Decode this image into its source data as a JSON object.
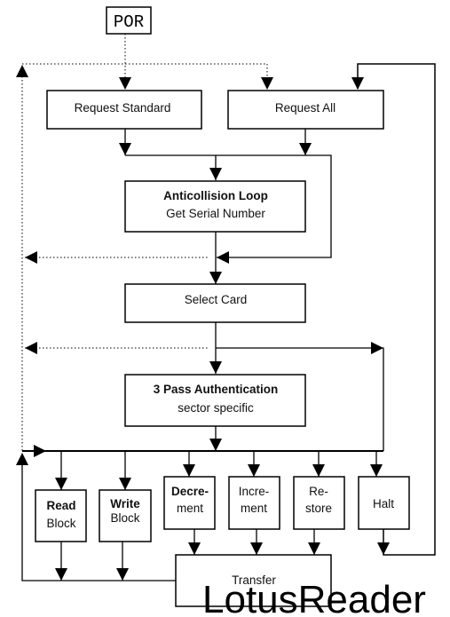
{
  "diagram": {
    "por": "POR",
    "request_standard": "Request Standard",
    "request_all": "Request All",
    "anticollision": {
      "line1": "Anticollision Loop",
      "line2": "Get Serial Number"
    },
    "select_card": "Select Card",
    "authentication": {
      "line1": "3 Pass Authentication",
      "line2": "sector specific"
    },
    "read_block": {
      "line1": "Read",
      "line2": "Block"
    },
    "write_block": {
      "line1": "Write",
      "line2": "Block"
    },
    "decrement": {
      "line1": "Decre-",
      "line2": "ment"
    },
    "increment": {
      "line1": "Incre-",
      "line2": "ment"
    },
    "restore": {
      "line1": "Re-",
      "line2": "store"
    },
    "halt": "Halt",
    "transfer": "Transfer"
  },
  "watermark": "LotusReader"
}
